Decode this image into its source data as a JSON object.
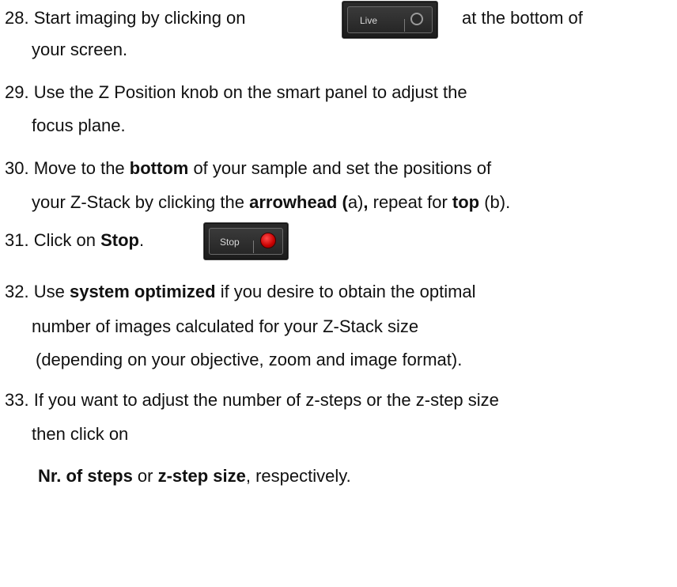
{
  "steps": [
    {
      "number": "28.",
      "line1_before": "Start imaging by clicking on",
      "line1_after": "at the bottom of",
      "line2": "your screen."
    },
    {
      "number": "29.",
      "line1": "Use the Z Position knob on the smart panel to adjust the",
      "line2": "focus plane."
    },
    {
      "number": "30.",
      "line1_a": "Move to the ",
      "line1_b": "bottom",
      "line1_c": " of your sample and set the positions of",
      "line2_a": "your Z-Stack by clicking the ",
      "line2_b": "arrowhead (",
      "line2_c": "a)",
      "line2_d": ",",
      "line2_e": " repeat for ",
      "line2_f": "top",
      "line2_g": " (b)."
    },
    {
      "number": "31.",
      "line1_a": "Click on ",
      "line1_b": "Stop",
      "line1_c": "."
    },
    {
      "number": "32.",
      "line1_a": "Use ",
      "line1_b": "system optimized",
      "line1_c": " if you desire to obtain the optimal",
      "line2": "number of images calculated for your Z-Stack size",
      "line3": "(depending on your objective, zoom and image format)."
    },
    {
      "number": "33.",
      "line1": "If you want to adjust the number of z-steps or the z-step size",
      "line2": "then click on",
      "line3_a": "Nr. of steps",
      "line3_b": " or ",
      "line3_c": "z-step size",
      "line3_d": ", respectively."
    }
  ],
  "buttons": {
    "live_label": "Live",
    "stop_label": "Stop"
  }
}
